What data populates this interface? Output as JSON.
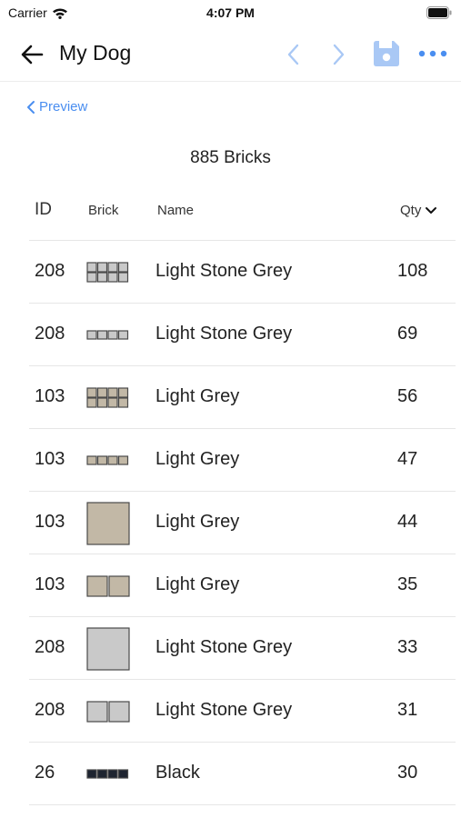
{
  "status_bar": {
    "carrier": "Carrier",
    "time": "4:07 PM"
  },
  "nav": {
    "title": "My Dog",
    "accent_color": "#4a8ef0"
  },
  "preview_link": {
    "label": "Preview"
  },
  "summary": {
    "brick_count": "885 Bricks"
  },
  "table": {
    "headers": {
      "id": "ID",
      "brick": "Brick",
      "name": "Name",
      "qty": "Qty"
    },
    "rows": [
      {
        "id": "208",
        "name": "Light Stone Grey",
        "qty": "108",
        "brick_icon": "brick-2x4-icon",
        "color": "#c9c9c9"
      },
      {
        "id": "208",
        "name": "Light Stone Grey",
        "qty": "69",
        "brick_icon": "brick-1x4-icon",
        "color": "#c9c9c9"
      },
      {
        "id": "103",
        "name": "Light Grey",
        "qty": "56",
        "brick_icon": "brick-2x4-icon",
        "color": "#c2b8a6"
      },
      {
        "id": "103",
        "name": "Light Grey",
        "qty": "47",
        "brick_icon": "brick-1x4-icon",
        "color": "#c2b8a6"
      },
      {
        "id": "103",
        "name": "Light Grey",
        "qty": "44",
        "brick_icon": "tile-square-icon",
        "color": "#c2b8a6"
      },
      {
        "id": "103",
        "name": "Light Grey",
        "qty": "35",
        "brick_icon": "brick-1x2-icon",
        "color": "#c2b8a6"
      },
      {
        "id": "208",
        "name": "Light Stone Grey",
        "qty": "33",
        "brick_icon": "tile-square-icon",
        "color": "#c9c9c9"
      },
      {
        "id": "208",
        "name": "Light Stone Grey",
        "qty": "31",
        "brick_icon": "brick-1x2-icon",
        "color": "#c9c9c9"
      },
      {
        "id": "26",
        "name": "Black",
        "qty": "30",
        "brick_icon": "brick-1x4-icon",
        "color": "#1e2430"
      }
    ]
  }
}
